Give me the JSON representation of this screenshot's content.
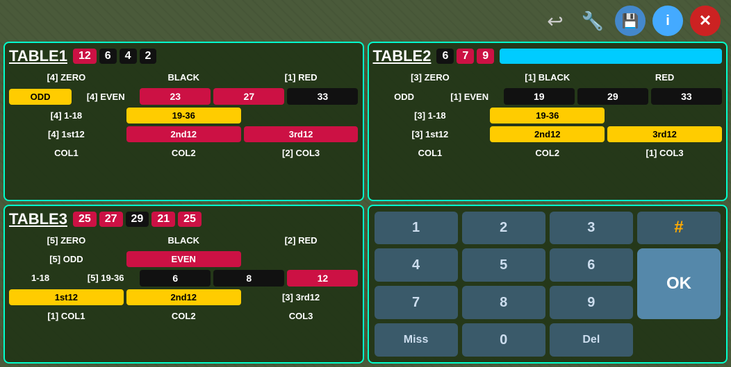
{
  "topbar": {
    "back_label": "↩",
    "wrench_label": "🔧",
    "save_label": "💾",
    "info_label": "i",
    "close_label": "✕"
  },
  "table1": {
    "title": "TABLE1",
    "badges": [
      {
        "value": "12",
        "type": "red"
      },
      {
        "value": "6",
        "type": "black"
      },
      {
        "value": "4",
        "type": "black"
      },
      {
        "value": "2",
        "type": "black"
      }
    ],
    "rows": [
      [
        {
          "label": "[4] ZERO",
          "style": "plain"
        },
        {
          "label": "BLACK",
          "style": "plain"
        },
        {
          "label": "[1] RED",
          "style": "plain"
        }
      ],
      [
        {
          "label": "ODD",
          "style": "yellow"
        },
        {
          "label": "[4] EVEN",
          "style": "plain"
        },
        {
          "label": "23",
          "style": "red"
        },
        {
          "label": "27",
          "style": "red"
        },
        {
          "label": "33",
          "style": "black"
        }
      ],
      [
        {
          "label": "[4] 1-18",
          "style": "plain"
        },
        {
          "label": "19-36",
          "style": "yellow"
        },
        {
          "label": "",
          "style": "plain"
        }
      ],
      [
        {
          "label": "[4] 1st12",
          "style": "plain"
        },
        {
          "label": "2nd12",
          "style": "crimson"
        },
        {
          "label": "3rd12",
          "style": "crimson"
        }
      ],
      [
        {
          "label": "COL1",
          "style": "plain"
        },
        {
          "label": "COL2",
          "style": "plain"
        },
        {
          "label": "[2] COL3",
          "style": "plain"
        }
      ]
    ]
  },
  "table2": {
    "title": "TABLE2",
    "badges": [
      {
        "value": "6",
        "type": "black"
      },
      {
        "value": "7",
        "type": "red"
      },
      {
        "value": "9",
        "type": "red"
      }
    ],
    "rows": [
      [
        {
          "label": "[3] ZERO",
          "style": "plain"
        },
        {
          "label": "[1] BLACK",
          "style": "plain"
        },
        {
          "label": "RED",
          "style": "plain"
        }
      ],
      [
        {
          "label": "ODD",
          "style": "plain"
        },
        {
          "label": "[1] EVEN",
          "style": "plain"
        },
        {
          "label": "19",
          "style": "black"
        },
        {
          "label": "29",
          "style": "black"
        },
        {
          "label": "33",
          "style": "black"
        }
      ],
      [
        {
          "label": "[3] 1-18",
          "style": "plain"
        },
        {
          "label": "19-36",
          "style": "yellow"
        },
        {
          "label": "",
          "style": "plain"
        }
      ],
      [
        {
          "label": "[3] 1st12",
          "style": "plain"
        },
        {
          "label": "2nd12",
          "style": "yellow"
        },
        {
          "label": "3rd12",
          "style": "yellow"
        }
      ],
      [
        {
          "label": "COL1",
          "style": "plain"
        },
        {
          "label": "COL2",
          "style": "plain"
        },
        {
          "label": "[1] COL3",
          "style": "plain"
        }
      ]
    ]
  },
  "table3": {
    "title": "TABLE3",
    "badges": [
      {
        "value": "25",
        "type": "red"
      },
      {
        "value": "27",
        "type": "red"
      },
      {
        "value": "29",
        "type": "black"
      },
      {
        "value": "21",
        "type": "red"
      },
      {
        "value": "25",
        "type": "red"
      }
    ],
    "rows": [
      [
        {
          "label": "[5] ZERO",
          "style": "plain"
        },
        {
          "label": "BLACK",
          "style": "plain"
        },
        {
          "label": "[2] RED",
          "style": "plain"
        }
      ],
      [
        {
          "label": "[5] ODD",
          "style": "plain"
        },
        {
          "label": "EVEN",
          "style": "crimson"
        },
        {
          "label": "",
          "style": "plain"
        }
      ],
      [
        {
          "label": "1-18",
          "style": "plain"
        },
        {
          "label": "[5] 19-36",
          "style": "plain"
        },
        {
          "label": "6",
          "style": "black"
        },
        {
          "label": "8",
          "style": "black"
        },
        {
          "label": "12",
          "style": "red"
        }
      ],
      [
        {
          "label": "1st12",
          "style": "yellow"
        },
        {
          "label": "2nd12",
          "style": "yellow"
        },
        {
          "label": "[3] 3rd12",
          "style": "plain"
        }
      ],
      [
        {
          "label": "[1] COL1",
          "style": "plain"
        },
        {
          "label": "COL2",
          "style": "plain"
        },
        {
          "label": "COL3",
          "style": "plain"
        }
      ]
    ]
  },
  "numpad": {
    "buttons": [
      "1",
      "2",
      "3",
      "#",
      "4",
      "5",
      "6",
      "",
      "7",
      "8",
      "9",
      "",
      "Miss",
      "0",
      "Del",
      "OK"
    ]
  }
}
